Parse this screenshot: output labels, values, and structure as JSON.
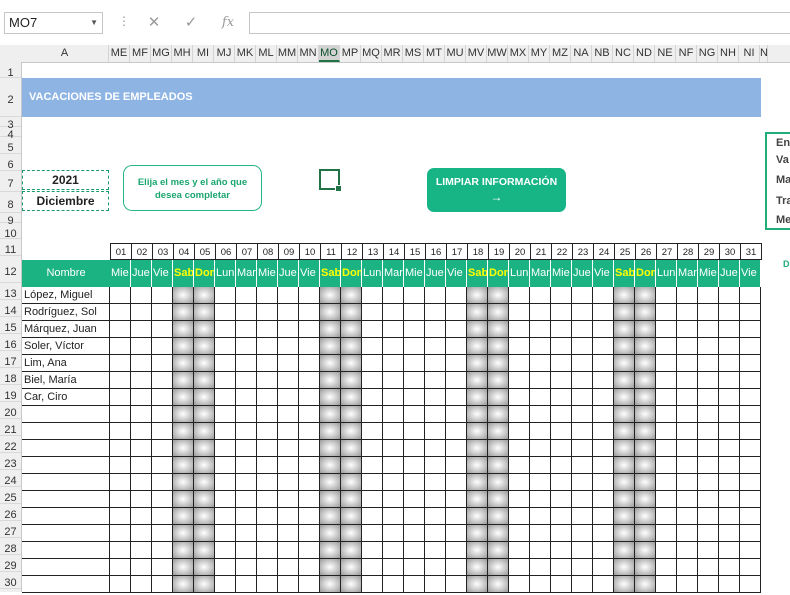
{
  "formula_bar": {
    "name_box": "MO7",
    "cancel_icon": "close-icon",
    "enter_icon": "check-icon",
    "fx_label": "fx",
    "formula": ""
  },
  "columns": [
    "A",
    "ME",
    "MF",
    "MG",
    "MH",
    "MI",
    "MJ",
    "MK",
    "ML",
    "MM",
    "MN",
    "MO",
    "MP",
    "MQ",
    "MR",
    "MS",
    "MT",
    "MU",
    "MV",
    "MW",
    "MX",
    "MY",
    "MZ",
    "NA",
    "NB",
    "NC",
    "ND",
    "NE",
    "NF",
    "NG",
    "NH",
    "NI",
    "N"
  ],
  "selected_column": "MO",
  "rows": [
    "1",
    "2",
    "3",
    "4",
    "5",
    "6",
    "7",
    "8",
    "9",
    "10",
    "11",
    "12",
    "13",
    "14",
    "15",
    "16",
    "17",
    "18",
    "19",
    "20",
    "21",
    "22",
    "23",
    "24",
    "25",
    "26",
    "27",
    "28",
    "29",
    "30"
  ],
  "title": "VACACIONES DE EMPLEADOS",
  "year": "2021",
  "month": "Diciembre",
  "hint_text": "Elija el mes y el año que desea completar",
  "clear_button": {
    "label": "LIMPIAR INFORMACIÓN",
    "arrow": "→"
  },
  "legend_items": [
    "Ent",
    "Va",
    "Ma",
    "Tra",
    "Me"
  ],
  "side_label": "D",
  "calendar": {
    "name_header": "Nombre",
    "days": [
      "01",
      "02",
      "03",
      "04",
      "05",
      "06",
      "07",
      "08",
      "09",
      "10",
      "11",
      "12",
      "13",
      "14",
      "15",
      "16",
      "17",
      "18",
      "19",
      "20",
      "21",
      "22",
      "23",
      "24",
      "25",
      "26",
      "27",
      "28",
      "29",
      "30",
      "31"
    ],
    "weekdays": [
      "Mie",
      "Jue",
      "Vie",
      "Sab",
      "Dom",
      "Lun",
      "Mar",
      "Mie",
      "Jue",
      "Vie",
      "Sab",
      "Dom",
      "Lun",
      "Mar",
      "Mie",
      "Jue",
      "Vie",
      "Sab",
      "Dom",
      "Lun",
      "Mar",
      "Mie",
      "Jue",
      "Vie",
      "Sab",
      "Dom",
      "Lun",
      "Mar",
      "Mie",
      "Jue",
      "Vie"
    ],
    "weekend_days": [
      4,
      5,
      11,
      12,
      18,
      19,
      25,
      26
    ],
    "employees": [
      "López, Miguel",
      "Rodríguez, Sol",
      "Márquez, Juan",
      "Soler, Víctor",
      "Lim, Ana",
      "Biel, María",
      "Car, Ciro",
      "",
      "",
      "",
      "",
      "",
      "",
      "",
      "",
      "",
      "",
      ""
    ]
  }
}
